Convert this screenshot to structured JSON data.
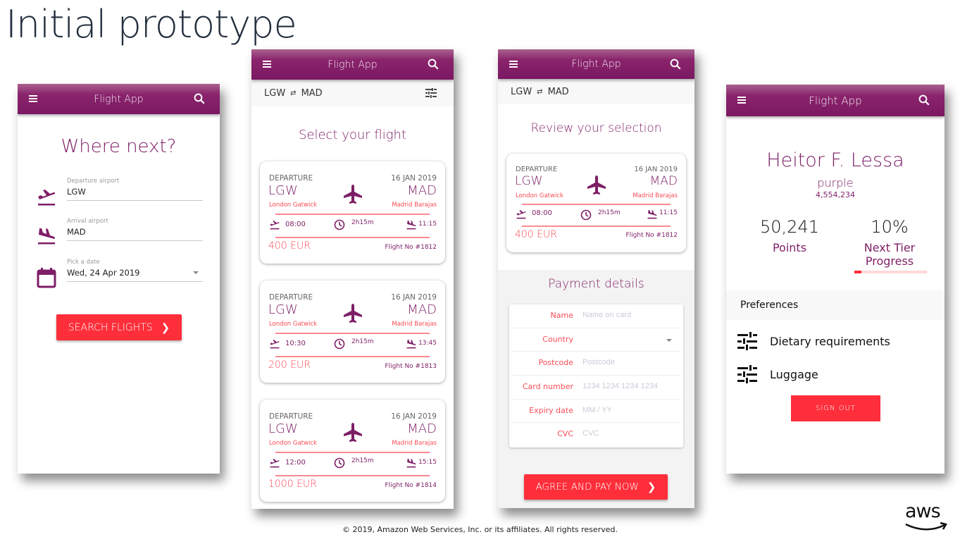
{
  "slide": {
    "title": "Initial prototype",
    "copyright": "© 2019, Amazon Web Services, Inc. or its affiliates. All rights reserved.",
    "logo": "aws"
  },
  "app": {
    "title": "Flight App",
    "brand_color": "#7b1862",
    "accent_color": "#fe2e3a",
    "icons": {
      "menu": "menu-icon",
      "search": "search-icon"
    }
  },
  "screen_search": {
    "heading": "Where next?",
    "departure": {
      "label": "Departure airport",
      "value": "LGW"
    },
    "arrival": {
      "label": "Arrival airport",
      "value": "MAD"
    },
    "date": {
      "label": "Pick a date",
      "value": "Wed, 24 Apr 2019"
    },
    "button": "SEARCH FLIGHTS"
  },
  "screen_select": {
    "route": {
      "from": "LGW",
      "swap": "⇄",
      "to": "MAD"
    },
    "heading": "Select your flight",
    "flights": [
      {
        "label": "DEPARTURE",
        "date": "16 JAN 2019",
        "from": "LGW",
        "from_name": "London Gatwick",
        "to": "MAD",
        "to_name": "Madrid Barajas",
        "departs": "08:00",
        "duration": "2h15m",
        "arrives": "11:15",
        "price": "400 EUR",
        "flight_no": "Flight No #1812"
      },
      {
        "label": "DEPARTURE",
        "date": "16 JAN 2019",
        "from": "LGW",
        "from_name": "London Gatwick",
        "to": "MAD",
        "to_name": "Madrid Barajas",
        "departs": "10:30",
        "duration": "2h15m",
        "arrives": "13:45",
        "price": "200 EUR",
        "flight_no": "Flight No #1813"
      },
      {
        "label": "DEPARTURE",
        "date": "16 JAN 2019",
        "from": "LGW",
        "from_name": "London Gatwick",
        "to": "MAD",
        "to_name": "Madrid Barajas",
        "departs": "12:00",
        "duration": "2h15m",
        "arrives": "15:15",
        "price": "1000 EUR",
        "flight_no": "Flight No #1814"
      }
    ]
  },
  "screen_review": {
    "route": {
      "from": "LGW",
      "swap": "⇄",
      "to": "MAD"
    },
    "heading": "Review your selection",
    "flight": {
      "label": "DEPARTURE",
      "date": "16 JAN 2019",
      "from": "LGW",
      "from_name": "London Gatwick",
      "to": "MAD",
      "to_name": "Madrid Barajas",
      "departs": "08:00",
      "duration": "2h15m",
      "arrives": "11:15",
      "price": "400 EUR",
      "flight_no": "Flight No #1812"
    },
    "payment_heading": "Payment details",
    "payment_fields": [
      {
        "label": "Name",
        "placeholder": "Name on card"
      },
      {
        "label": "Country",
        "placeholder": ""
      },
      {
        "label": "Postcode",
        "placeholder": "Postcode"
      },
      {
        "label": "Card number",
        "placeholder": "1234 1234 1234 1234"
      },
      {
        "label": "Expiry date",
        "placeholder": "MM / YY"
      },
      {
        "label": "CVC",
        "placeholder": "CVC"
      }
    ],
    "button": "AGREE AND PAY NOW"
  },
  "screen_profile": {
    "name": "Heitor F. Lessa",
    "tier": "purple",
    "member_id": "4,554,234",
    "points": {
      "value": "50,241",
      "label": "Points"
    },
    "progress": {
      "value": "10%",
      "label": "Next Tier Progress",
      "fraction": 0.1
    },
    "preferences_heading": "Preferences",
    "preferences": [
      "Dietary requirements",
      "Luggage"
    ],
    "button": "SIGN OUT"
  }
}
